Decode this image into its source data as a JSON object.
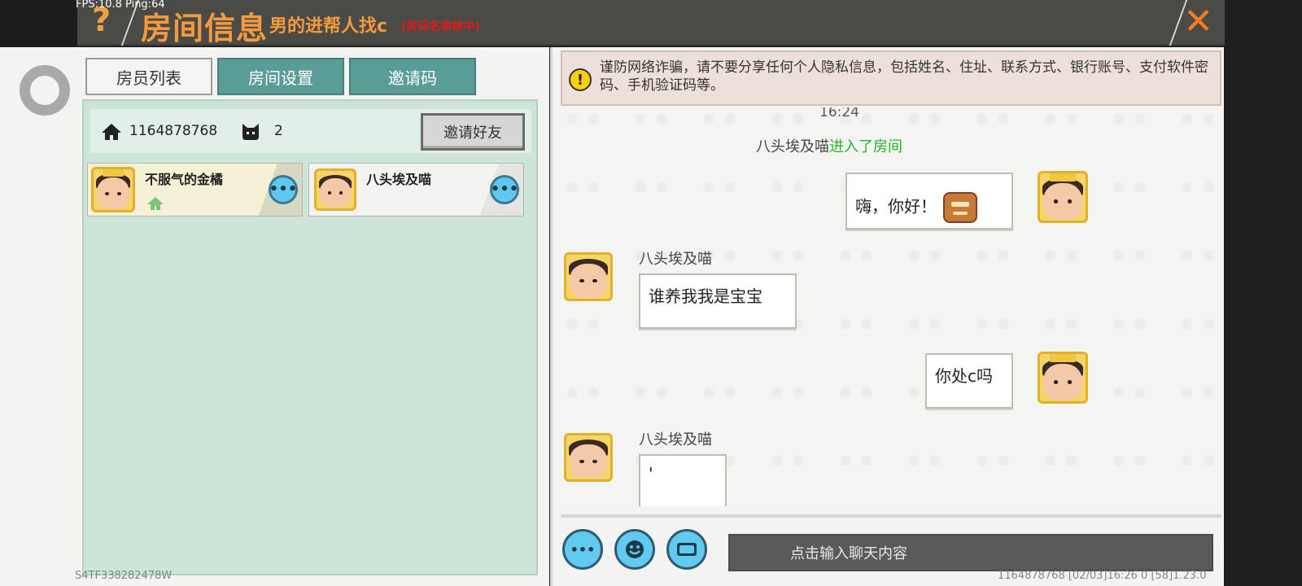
{
  "debug": {
    "fps_text": "FPS:10.8  Ping:64"
  },
  "header": {
    "help_label": "?",
    "title": "房间信息",
    "room_name": "男的进帮人找c",
    "room_name_status": "(房间名审核中)",
    "close_label": "✕"
  },
  "tabs": [
    {
      "label": "房员列表",
      "active": true
    },
    {
      "label": "房间设置",
      "active": false
    },
    {
      "label": "邀请码",
      "active": false
    }
  ],
  "room": {
    "id": "1164878768",
    "member_count": "2",
    "invite_button": "邀请好友"
  },
  "members": [
    {
      "name": "不服气的金橘",
      "is_host": true
    },
    {
      "name": "八头埃及喵",
      "is_host": false
    }
  ],
  "device_id": "S4TF338282478W",
  "chat": {
    "warning": "谨防网络诈骗，请不要分享任何个人隐私信息，包括姓名、住址、联系方式、银行账号、支付软件密码、手机验证码等。",
    "time": "16:24",
    "system_user": "八头埃及喵",
    "system_action": "进入了房间",
    "messages": [
      {
        "side": "right",
        "sender": "",
        "text": "嗨，你好！"
      },
      {
        "side": "left",
        "sender": "八头埃及喵",
        "text": "谁养我我是宝宝"
      },
      {
        "side": "right",
        "sender": "",
        "text": "你处c吗"
      },
      {
        "side": "left",
        "sender": "八头埃及喵",
        "text": "'"
      }
    ],
    "input_placeholder": "点击输入聊天内容"
  },
  "status_bar": "1164878768   [02/03]16:26 0   [58]1.23.0"
}
